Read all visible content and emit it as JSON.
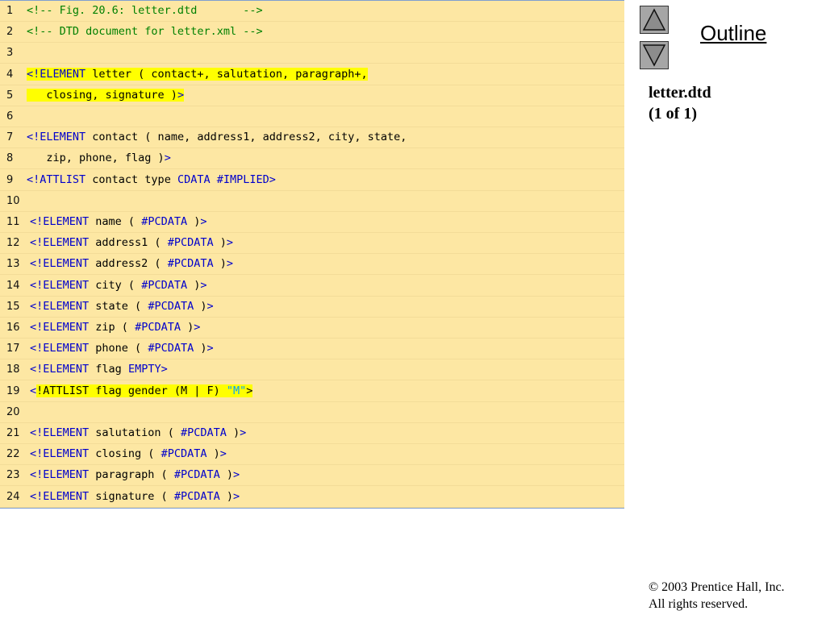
{
  "colors": {
    "panel_background": "#fde7a3",
    "tag": "#0000cc",
    "comment": "#008000",
    "keyword": "#0000cc",
    "string": "#00a0ff",
    "highlight": "#ffff00"
  },
  "code": {
    "lines": [
      {
        "number": "1",
        "tokens": [
          {
            "text": "<!-- Fig. 20.6: letter.dtd       -->",
            "color": "#008000"
          }
        ]
      },
      {
        "number": "2",
        "tokens": [
          {
            "text": "<!-- DTD document for letter.xml -->",
            "color": "#008000"
          }
        ]
      },
      {
        "number": "3",
        "tokens": []
      },
      {
        "number": "4",
        "tokens": [
          {
            "text": "<!ELEMENT",
            "color": "#0000cc",
            "hl": true
          },
          {
            "text": " letter ( contact+, salutation, paragraph+,",
            "color": "#000000",
            "hl": true
          }
        ]
      },
      {
        "number": "5",
        "tokens": [
          {
            "text": "   closing, signature )",
            "color": "#000000",
            "hl": true
          },
          {
            "text": ">",
            "color": "#0000cc",
            "hl": true
          }
        ]
      },
      {
        "number": "6",
        "tokens": []
      },
      {
        "number": "7",
        "tokens": [
          {
            "text": "<!ELEMENT",
            "color": "#0000cc"
          },
          {
            "text": " contact ( name, address1, address2, city, state,",
            "color": "#000000"
          }
        ]
      },
      {
        "number": "8",
        "tokens": [
          {
            "text": "   zip, phone, flag )",
            "color": "#000000"
          },
          {
            "text": ">",
            "color": "#0000cc"
          }
        ]
      },
      {
        "number": "9",
        "tokens": [
          {
            "text": "<!ATTLIST",
            "color": "#0000cc"
          },
          {
            "text": " contact type ",
            "color": "#000000"
          },
          {
            "text": "CDATA #IMPLIED>",
            "color": "#0000cc"
          }
        ]
      },
      {
        "number": "10",
        "tokens": []
      },
      {
        "number": "11",
        "shift": true,
        "tokens": [
          {
            "text": "<!ELEMENT",
            "color": "#0000cc"
          },
          {
            "text": " name ( ",
            "color": "#000000"
          },
          {
            "text": "#PCDATA",
            "color": "#0000cc"
          },
          {
            "text": " )",
            "color": "#000000"
          },
          {
            "text": ">",
            "color": "#0000cc"
          }
        ]
      },
      {
        "number": "12",
        "shift": true,
        "tokens": [
          {
            "text": "<!ELEMENT",
            "color": "#0000cc"
          },
          {
            "text": " address1 ( ",
            "color": "#000000"
          },
          {
            "text": "#PCDATA",
            "color": "#0000cc"
          },
          {
            "text": " )",
            "color": "#000000"
          },
          {
            "text": ">",
            "color": "#0000cc"
          }
        ]
      },
      {
        "number": "13",
        "shift": true,
        "tokens": [
          {
            "text": "<!ELEMENT",
            "color": "#0000cc"
          },
          {
            "text": " address2 ( ",
            "color": "#000000"
          },
          {
            "text": "#PCDATA",
            "color": "#0000cc"
          },
          {
            "text": " )",
            "color": "#000000"
          },
          {
            "text": ">",
            "color": "#0000cc"
          }
        ]
      },
      {
        "number": "14",
        "shift": true,
        "tokens": [
          {
            "text": "<!ELEMENT",
            "color": "#0000cc"
          },
          {
            "text": " city ( ",
            "color": "#000000"
          },
          {
            "text": "#PCDATA",
            "color": "#0000cc"
          },
          {
            "text": " )",
            "color": "#000000"
          },
          {
            "text": ">",
            "color": "#0000cc"
          }
        ]
      },
      {
        "number": "15",
        "shift": true,
        "tokens": [
          {
            "text": "<!ELEMENT",
            "color": "#0000cc"
          },
          {
            "text": " state ( ",
            "color": "#000000"
          },
          {
            "text": "#PCDATA",
            "color": "#0000cc"
          },
          {
            "text": " )",
            "color": "#000000"
          },
          {
            "text": ">",
            "color": "#0000cc"
          }
        ]
      },
      {
        "number": "16",
        "shift": true,
        "tokens": [
          {
            "text": "<!ELEMENT",
            "color": "#0000cc"
          },
          {
            "text": " zip ( ",
            "color": "#000000"
          },
          {
            "text": "#PCDATA",
            "color": "#0000cc"
          },
          {
            "text": " )",
            "color": "#000000"
          },
          {
            "text": ">",
            "color": "#0000cc"
          }
        ]
      },
      {
        "number": "17",
        "shift": true,
        "tokens": [
          {
            "text": "<!ELEMENT",
            "color": "#0000cc"
          },
          {
            "text": " phone ( ",
            "color": "#000000"
          },
          {
            "text": "#PCDATA",
            "color": "#0000cc"
          },
          {
            "text": " )",
            "color": "#000000"
          },
          {
            "text": ">",
            "color": "#0000cc"
          }
        ]
      },
      {
        "number": "18",
        "shift": true,
        "tokens": [
          {
            "text": "<!ELEMENT",
            "color": "#0000cc"
          },
          {
            "text": " flag ",
            "color": "#000000"
          },
          {
            "text": "EMPTY>",
            "color": "#0000cc"
          }
        ]
      },
      {
        "number": "19",
        "shift": true,
        "tokens": [
          {
            "text": "<",
            "color": "#0000cc"
          },
          {
            "text": "!ATTLIST flag gender (M | F) ",
            "color": "#000000",
            "hl": true
          },
          {
            "text": "\"M\"",
            "color": "#00a0ff",
            "hl": true
          },
          {
            "text": ">",
            "color": "#000000",
            "hl": true
          }
        ]
      },
      {
        "number": "20",
        "tokens": []
      },
      {
        "number": "21",
        "shift": true,
        "tokens": [
          {
            "text": "<!ELEMENT",
            "color": "#0000cc"
          },
          {
            "text": " salutation ( ",
            "color": "#000000"
          },
          {
            "text": "#PCDATA",
            "color": "#0000cc"
          },
          {
            "text": " )",
            "color": "#000000"
          },
          {
            "text": ">",
            "color": "#0000cc"
          }
        ]
      },
      {
        "number": "22",
        "shift": true,
        "tokens": [
          {
            "text": "<!ELEMENT",
            "color": "#0000cc"
          },
          {
            "text": " closing ( ",
            "color": "#000000"
          },
          {
            "text": "#PCDATA",
            "color": "#0000cc"
          },
          {
            "text": " )",
            "color": "#000000"
          },
          {
            "text": ">",
            "color": "#0000cc"
          }
        ]
      },
      {
        "number": "23",
        "shift": true,
        "tokens": [
          {
            "text": "<!ELEMENT",
            "color": "#0000cc"
          },
          {
            "text": " paragraph ( ",
            "color": "#000000"
          },
          {
            "text": "#PCDATA",
            "color": "#0000cc"
          },
          {
            "text": " )",
            "color": "#000000"
          },
          {
            "text": ">",
            "color": "#0000cc"
          }
        ]
      },
      {
        "number": "24",
        "shift": true,
        "tokens": [
          {
            "text": "<!ELEMENT",
            "color": "#0000cc"
          },
          {
            "text": " signature ( ",
            "color": "#000000"
          },
          {
            "text": "#PCDATA",
            "color": "#0000cc"
          },
          {
            "text": " )",
            "color": "#000000"
          },
          {
            "text": ">",
            "color": "#0000cc"
          }
        ]
      }
    ]
  },
  "sidebar": {
    "nav_up_icon": "triangle-up-icon",
    "nav_down_icon": "triangle-down-icon",
    "outline_label": "Outline",
    "file_name": "letter.dtd",
    "page_indicator": "(1 of 1)"
  },
  "footer": {
    "copyright": "© 2003 Prentice Hall, Inc.",
    "rights": "All rights reserved."
  }
}
